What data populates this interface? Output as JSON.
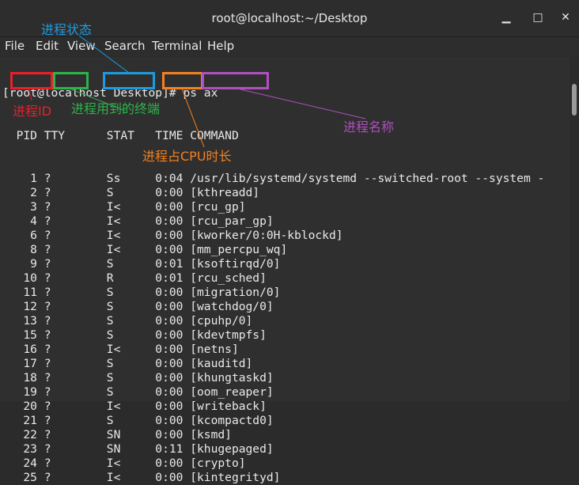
{
  "window": {
    "title": "root@localhost:~/Desktop",
    "minimize_icon": "minimize-icon",
    "maximize_icon": "maximize-icon",
    "close_icon": "close-icon",
    "minimize_glyph": "▁",
    "maximize_glyph": "□",
    "close_glyph": "✕"
  },
  "menu": [
    "File",
    "Edit",
    "View",
    "Search",
    "Terminal",
    "Help"
  ],
  "terminal": {
    "prompt": "[root@localhost Desktop]# ps ax",
    "header": "  PID TTY      STAT   TIME COMMAND",
    "rows": [
      "    1 ?        Ss     0:04 /usr/lib/systemd/systemd --switched-root --system -",
      "    2 ?        S      0:00 [kthreadd]",
      "    3 ?        I<     0:00 [rcu_gp]",
      "    4 ?        I<     0:00 [rcu_par_gp]",
      "    6 ?        I<     0:00 [kworker/0:0H-kblockd]",
      "    8 ?        I<     0:00 [mm_percpu_wq]",
      "    9 ?        S      0:01 [ksoftirqd/0]",
      "   10 ?        R      0:01 [rcu_sched]",
      "   11 ?        S      0:00 [migration/0]",
      "   12 ?        S      0:00 [watchdog/0]",
      "   13 ?        S      0:00 [cpuhp/0]",
      "   15 ?        S      0:00 [kdevtmpfs]",
      "   16 ?        I<     0:00 [netns]",
      "   17 ?        S      0:00 [kauditd]",
      "   18 ?        S      0:00 [khungtaskd]",
      "   19 ?        S      0:00 [oom_reaper]",
      "   20 ?        I<     0:00 [writeback]",
      "   21 ?        S      0:00 [kcompactd0]",
      "   22 ?        SN     0:00 [ksmd]",
      "   23 ?        SN     0:11 [khugepaged]",
      "   24 ?        I<     0:00 [crypto]",
      "   25 ?        I<     0:00 [kintegrityd]"
    ]
  },
  "annotations": {
    "pid": {
      "text": "进程ID",
      "color": "#e8202a"
    },
    "tty": {
      "text": "进程用到的终端",
      "color": "#2db34a"
    },
    "stat": {
      "text": "进程状态",
      "color": "#1e9be0"
    },
    "time": {
      "text": "进程占CPU时长",
      "color": "#f4801f"
    },
    "command": {
      "text": "进程名称",
      "color": "#b04fc0"
    }
  }
}
